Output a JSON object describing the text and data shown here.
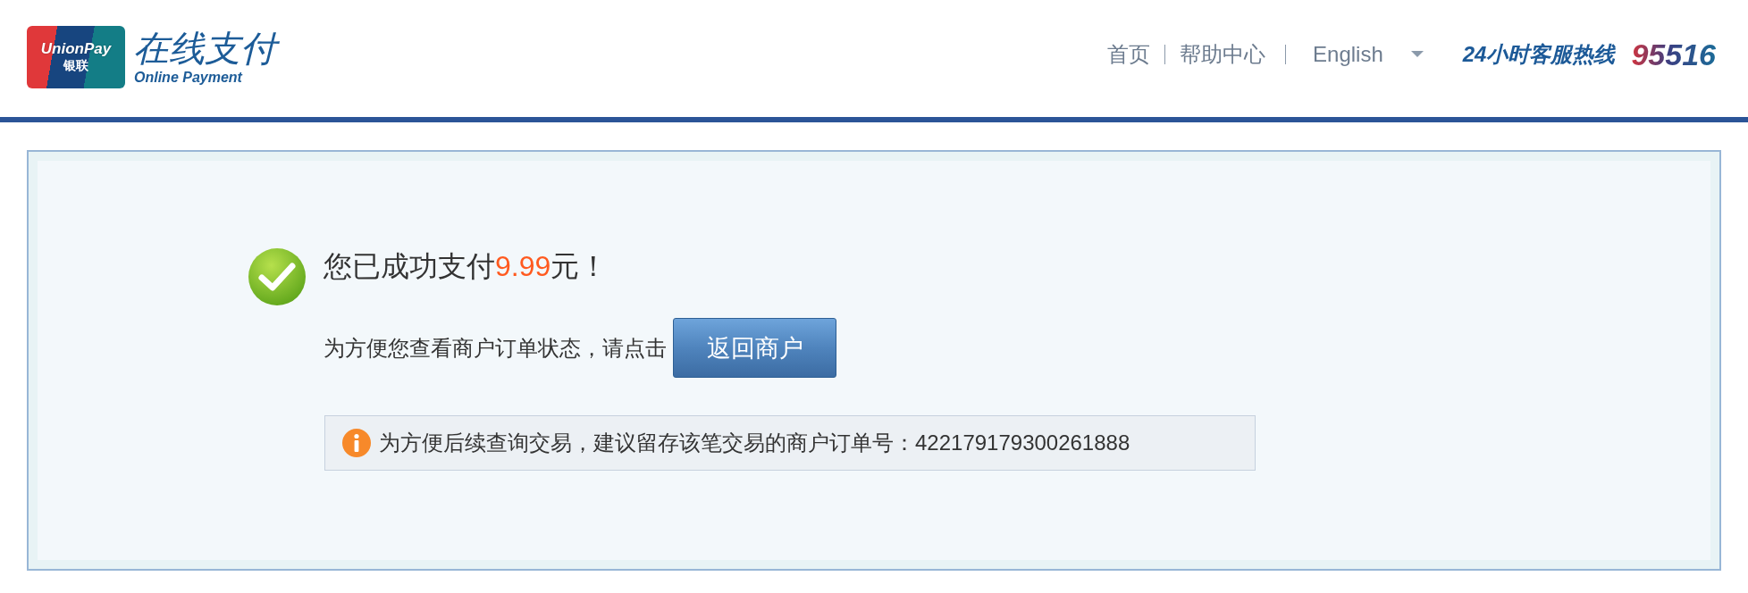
{
  "header": {
    "logo": {
      "card_text": "UnionPay",
      "card_text_cn": "银联",
      "title": "在线支付",
      "subtitle": "Online Payment"
    },
    "nav": [
      {
        "label": "首页"
      },
      {
        "label": "帮助中心"
      }
    ],
    "language": {
      "label": "English"
    },
    "hotline": {
      "label": "24小时客服热线",
      "number": "95516"
    }
  },
  "result": {
    "title_prefix": "您已成功支付",
    "amount": "9.99",
    "title_suffix": "元！",
    "instruction": "为方便您查看商户订单状态，请点击",
    "button": "返回商户",
    "notice": "为方便后续查询交易，建议留存该笔交易的商户订单号：422179179300261888"
  }
}
